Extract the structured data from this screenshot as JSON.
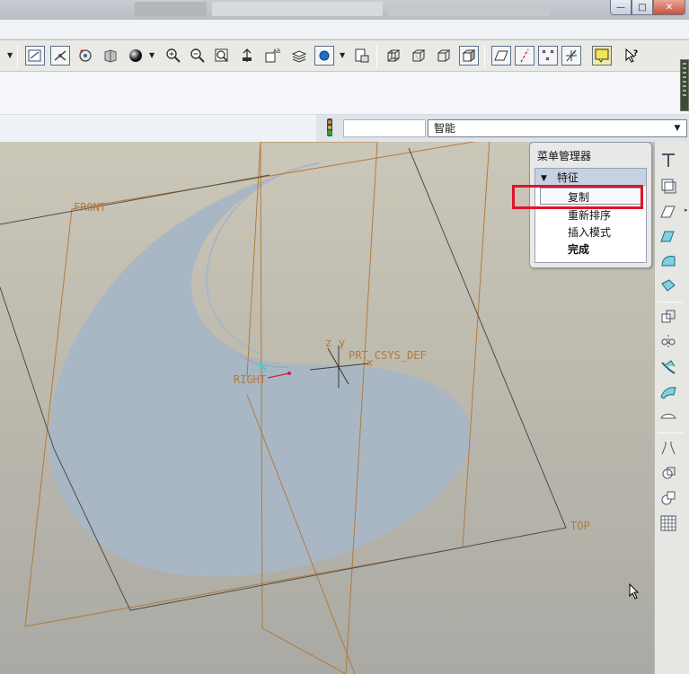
{
  "toolbar": {
    "filter_value": "智能",
    "dropdown_arrow": "▼"
  },
  "model_tree_labels": {
    "front": "FRONT",
    "right": "RIGHT",
    "top": "TOP",
    "csys": "PRT_CSYS_DEF",
    "csys_axes_z": "z",
    "csys_axes_y": "y",
    "csys_axes_x": "x"
  },
  "menu_manager": {
    "title": "菜单管理器",
    "section": "特征",
    "items": [
      {
        "label": "复制",
        "selected": true
      },
      {
        "label": "重新排序",
        "selected": false
      },
      {
        "label": "插入模式",
        "selected": false
      },
      {
        "label": "完成",
        "selected": false
      }
    ]
  },
  "colors": {
    "datum_plane": "#b37a3c",
    "surface_fill": "#a9b7c4",
    "highlight_box": "#e0142a",
    "canvas_top": "#cbc7b9",
    "canvas_bottom": "#aaa9a4"
  },
  "icons": {
    "toolbar": [
      "redraw-icon",
      "spin-center-icon",
      "orient-icon",
      "saved-views-icon",
      "shading-sphere-icon",
      "zoom-in-icon",
      "zoom-out-icon",
      "refit-icon",
      "reorient-icon",
      "view-manager-icon",
      "layers-icon",
      "appearance-icon",
      "model-display-icon",
      "wireframe-icon",
      "hidden-line-icon",
      "no-hidden-icon",
      "shading-icon",
      "datum-planes-icon",
      "datum-axes-icon",
      "datum-points-icon",
      "csys-icon",
      "annotations-icon",
      "whats-this-icon"
    ],
    "right": [
      "datum-plane-tool-icon",
      "datum-axis-tool-icon",
      "datum-curve-icon",
      "datum-point-icon",
      "csys-tool-icon",
      "analysis-icon",
      "mirror-icon",
      "move-icon",
      "merge-icon",
      "trim-icon",
      "extend-icon",
      "offset-icon",
      "thicken-icon",
      "solidify-icon",
      "intersect-icon",
      "pattern-icon"
    ]
  }
}
